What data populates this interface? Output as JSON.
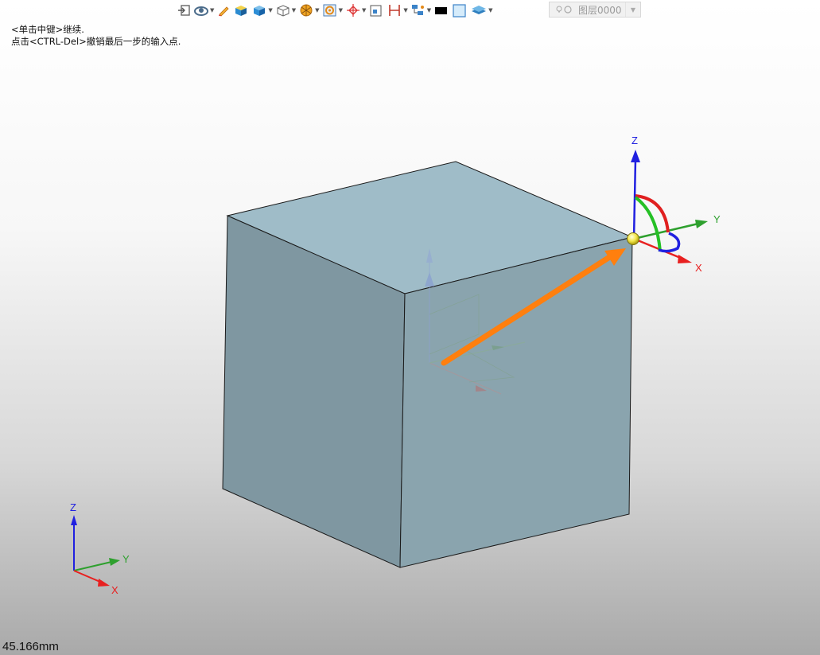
{
  "toolbar": {
    "items": [
      {
        "icon": "exit-icon",
        "has_dropdown": false
      },
      {
        "icon": "view-orientation-icon",
        "has_dropdown": true
      },
      {
        "icon": "pencil-icon",
        "has_dropdown": false
      },
      {
        "icon": "shaded-box-icon",
        "has_dropdown": false
      },
      {
        "icon": "blue-box-icon",
        "has_dropdown": true
      },
      {
        "icon": "wireframe-box-icon",
        "has_dropdown": true
      },
      {
        "icon": "filter-icon",
        "has_dropdown": true
      },
      {
        "icon": "target-select-icon",
        "has_dropdown": true
      },
      {
        "icon": "snap-point-icon",
        "has_dropdown": true
      },
      {
        "icon": "zoom-fit-icon",
        "has_dropdown": false
      },
      {
        "icon": "dimension-icon",
        "has_dropdown": true
      },
      {
        "icon": "hierarchy-icon",
        "has_dropdown": true
      },
      {
        "icon": "black-color-icon",
        "has_dropdown": false
      },
      {
        "icon": "face-color-icon",
        "has_dropdown": false
      },
      {
        "icon": "layers-icon",
        "has_dropdown": true
      }
    ],
    "layer_label": "图层0000"
  },
  "prompt": {
    "line1": "<单击中键>继续.",
    "line2": "点击<CTRL-Del>撤销最后一步的输入点."
  },
  "triad": {
    "x_label": "X",
    "y_label": "Y",
    "z_label": "Z"
  },
  "corner_triad": {
    "x_label": "X",
    "y_label": "Y",
    "z_label": "Z"
  },
  "measurement": "45.166mm",
  "colors": {
    "cube_top": "#9fbcc8",
    "cube_left": "#7f97a1",
    "cube_right": "#8aa4ae",
    "drag_arrow": "#ff7f0e",
    "axis_x": "#e82020",
    "axis_y": "#2ea02e",
    "axis_z": "#2020e0"
  }
}
